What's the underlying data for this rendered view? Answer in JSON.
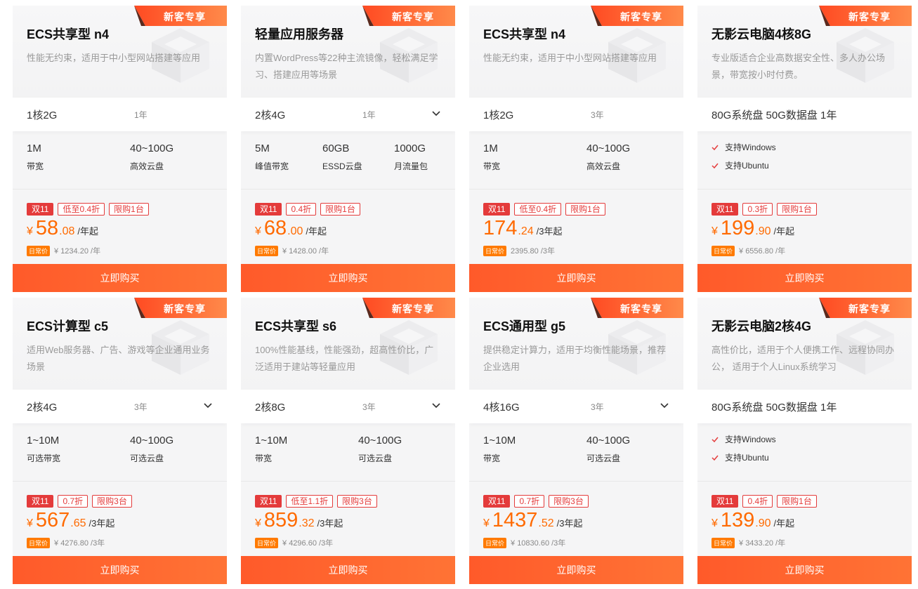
{
  "common": {
    "badge": "新客专享",
    "buy_label": "立即购买",
    "daily_tag": "日常价",
    "currency": "¥"
  },
  "cards": [
    {
      "title": "ECS共享型 n4",
      "desc": "性能无约束，适用于中小型网站搭建等应用",
      "spec": "1核2G",
      "term": "1年",
      "dropdown": false,
      "stats": [
        {
          "v": "1M",
          "l": "带宽"
        },
        {
          "v": "40~100G",
          "l": "高效云盘"
        }
      ],
      "features": [],
      "tags": [
        "双11",
        "低至0.4折",
        "限购1台"
      ],
      "price_cur": "¥",
      "price_int": "58",
      "price_dec": ".08",
      "price_unit": "/年起",
      "daily_price": "¥ 1234.20 /年"
    },
    {
      "title": "轻量应用服务器",
      "desc": "内置WordPress等22种主流镜像，轻松满足学习、搭建应用等场景",
      "spec": "2核4G",
      "term": "1年",
      "dropdown": true,
      "stats": [
        {
          "v": "5M",
          "l": "峰值带宽"
        },
        {
          "v": "60GB",
          "l": "ESSD云盘"
        },
        {
          "v": "1000G",
          "l": "月流量包"
        }
      ],
      "features": [],
      "tags": [
        "双11",
        "0.4折",
        "限购1台"
      ],
      "price_cur": "¥",
      "price_int": "68",
      "price_dec": ".00",
      "price_unit": "/年起",
      "daily_price": "¥ 1428.00 /年"
    },
    {
      "title": "ECS共享型 n4",
      "desc": "性能无约束，适用于中小型网站搭建等应用",
      "spec": "1核2G",
      "term": "3年",
      "dropdown": false,
      "stats": [
        {
          "v": "1M",
          "l": "带宽"
        },
        {
          "v": "40~100G",
          "l": "高效云盘"
        }
      ],
      "features": [],
      "tags": [
        "双11",
        "低至0.4折",
        "限购1台"
      ],
      "price_cur": "",
      "price_int": "174",
      "price_dec": ".24",
      "price_unit": "/3年起",
      "daily_price": "2395.80 /3年"
    },
    {
      "title": "无影云电脑4核8G",
      "desc": "专业版适合企业高数据安全性、多人办公场景，带宽按小时付费。",
      "spec": "80G系统盘 50G数据盘 1年",
      "term": "",
      "dropdown": false,
      "stats": [],
      "features": [
        "支持Windows",
        "支持Ubuntu"
      ],
      "tags": [
        "双11",
        "0.3折",
        "限购1台"
      ],
      "price_cur": "¥",
      "price_int": "199",
      "price_dec": ".90",
      "price_unit": "/年起",
      "daily_price": "¥ 6556.80 /年"
    },
    {
      "title": "ECS计算型 c5",
      "desc": "适用Web服务器、广告、游戏等企业通用业务场景",
      "spec": "2核4G",
      "term": "3年",
      "dropdown": true,
      "stats": [
        {
          "v": "1~10M",
          "l": "可选带宽"
        },
        {
          "v": "40~100G",
          "l": "可选云盘"
        }
      ],
      "features": [],
      "tags": [
        "双11",
        "0.7折",
        "限购3台"
      ],
      "price_cur": "¥",
      "price_int": "567",
      "price_dec": ".65",
      "price_unit": "/3年起",
      "daily_price": "¥ 4276.80 /3年"
    },
    {
      "title": "ECS共享型 s6",
      "desc": "100%性能基线，性能强劲，超高性价比，广泛适用于建站等轻量应用",
      "spec": "2核8G",
      "term": "3年",
      "dropdown": true,
      "stats": [
        {
          "v": "1~10M",
          "l": "带宽"
        },
        {
          "v": "40~100G",
          "l": "可选云盘"
        }
      ],
      "features": [],
      "tags": [
        "双11",
        "低至1.1折",
        "限购3台"
      ],
      "price_cur": "¥",
      "price_int": "859",
      "price_dec": ".32",
      "price_unit": "/3年起",
      "daily_price": "¥ 4296.60 /3年"
    },
    {
      "title": "ECS通用型 g5",
      "desc": "提供稳定计算力，适用于均衡性能场景，推荐企业选用",
      "spec": "4核16G",
      "term": "3年",
      "dropdown": true,
      "stats": [
        {
          "v": "1~10M",
          "l": "带宽"
        },
        {
          "v": "40~100G",
          "l": "可选云盘"
        }
      ],
      "features": [],
      "tags": [
        "双11",
        "0.7折",
        "限购3台"
      ],
      "price_cur": "¥",
      "price_int": "1437",
      "price_dec": ".52",
      "price_unit": "/3年起",
      "daily_price": "¥ 10830.60 /3年"
    },
    {
      "title": "无影云电脑2核4G",
      "desc": "高性价比，适用于个人便携工作、远程协同办公， 适用于个人Linux系统学习",
      "spec": "80G系统盘 50G数据盘 1年",
      "term": "",
      "dropdown": false,
      "stats": [],
      "features": [
        "支持Windows",
        "支持Ubuntu"
      ],
      "tags": [
        "双11",
        "0.4折",
        "限购1台"
      ],
      "price_cur": "¥",
      "price_int": "139",
      "price_dec": ".90",
      "price_unit": "/年起",
      "daily_price": "¥ 3433.20 /年"
    }
  ]
}
